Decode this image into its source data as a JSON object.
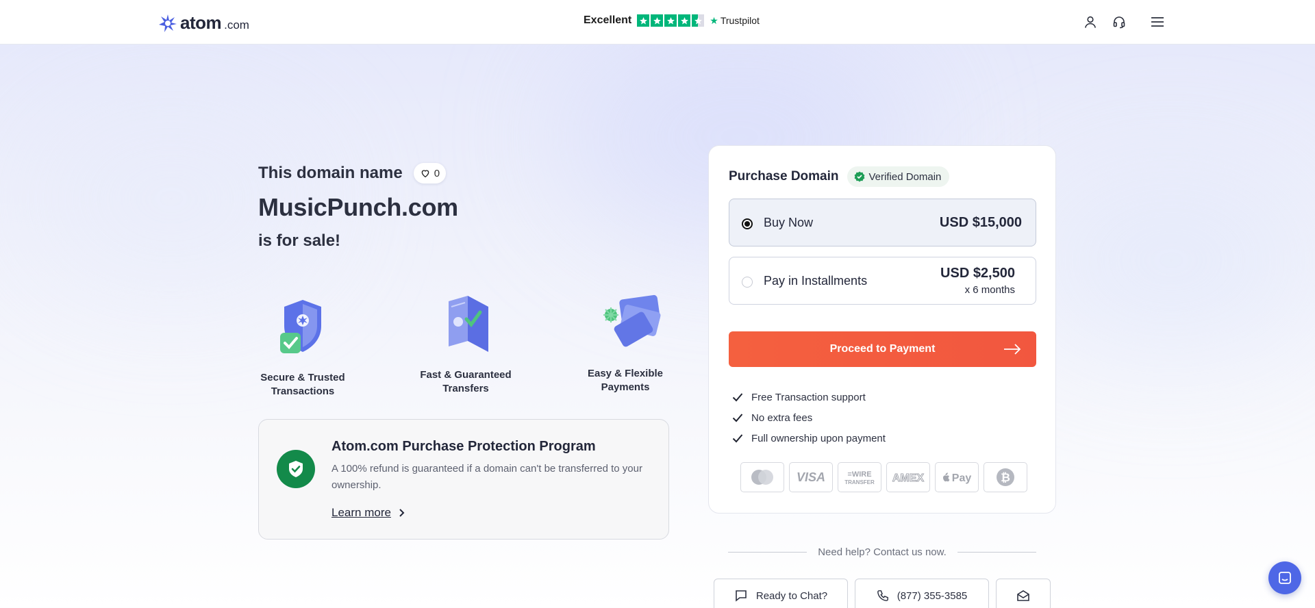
{
  "header": {
    "logo_word": "atom",
    "logo_tld": ".com",
    "trust_rating_label": "Excellent",
    "trust_brand": "Trustpilot",
    "trust_stars": 4.5,
    "icons": [
      "user-icon",
      "headset-icon",
      "menu-icon"
    ]
  },
  "intro": {
    "pre": "This domain name",
    "likes": "0",
    "domain": "MusicPunch.com",
    "sale": "is for sale!"
  },
  "features": [
    {
      "label": "Secure & Trusted Transactions",
      "icon": "shield-check-icon"
    },
    {
      "label": "Fast & Guaranteed Transfers",
      "icon": "transfer-icon"
    },
    {
      "label": "Easy & Flexible Payments",
      "icon": "cards-icon"
    }
  ],
  "protection": {
    "title": "Atom.com Purchase Protection Program",
    "desc": "A 100% refund is guaranteed if a domain can't be transferred to your ownership.",
    "learn": "Learn more"
  },
  "purchase": {
    "title": "Purchase Domain",
    "verified": "Verified Domain",
    "options": [
      {
        "label": "Buy Now",
        "price": "USD $15,000",
        "selected": true
      },
      {
        "label": "Pay in Installments",
        "price": "USD $2,500",
        "sub": "x 6 months",
        "selected": false
      }
    ],
    "proceed": "Proceed to Payment",
    "benefits": [
      "Free Transaction support",
      "No extra fees",
      "Full ownership upon payment"
    ],
    "payments": [
      "mastercard-icon",
      "visa-icon",
      "wire-transfer-icon",
      "amex-icon",
      "apple-pay-icon",
      "bitcoin-icon"
    ]
  },
  "help": {
    "text": "Need help? Contact us now.",
    "chat": "Ready to Chat?",
    "phone": "(877) 355-3585"
  },
  "colors": {
    "accent": "#f4603f",
    "brand": "#4e67e6",
    "trust_green": "#00b67a",
    "protect_green": "#138a4a"
  }
}
